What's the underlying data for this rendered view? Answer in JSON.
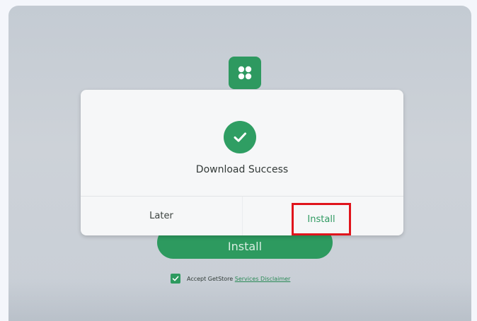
{
  "dialog": {
    "message": "Download Success",
    "later_label": "Later",
    "install_label": "Install",
    "success_icon": "check-circle-icon"
  },
  "background": {
    "install_label": "Install",
    "accept_text": "Accept GetStore",
    "accept_link": "Services Disclaimer",
    "accept_checked": true,
    "app_icon": "app-grid-icon"
  },
  "colors": {
    "accent": "#2e9960",
    "highlight": "#e0141c",
    "dialog_bg": "#f6f7f8"
  }
}
